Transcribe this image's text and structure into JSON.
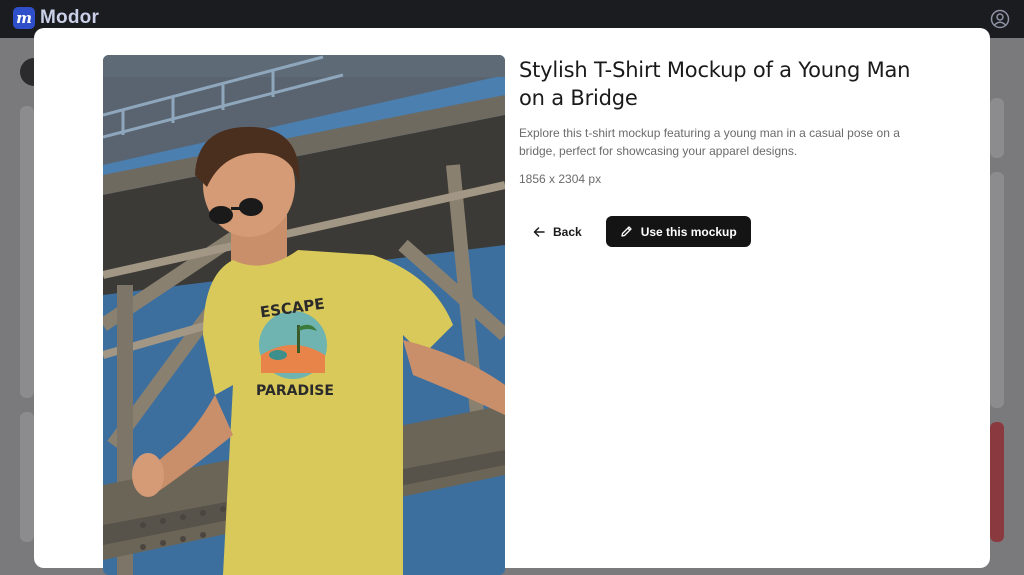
{
  "app": {
    "brand_letter": "m",
    "brand_name": "Modor"
  },
  "modal": {
    "title": "Stylish T-Shirt Mockup of a Young Man on a Bridge",
    "description": "Explore this t-shirt mockup featuring a young man in a casual pose on a bridge, perfect for showcasing your apparel designs.",
    "dimensions": "1856 x 2304 px",
    "back_label": "Back",
    "use_label": "Use this mockup"
  },
  "shirt_print": {
    "line1": "ESCAPE",
    "line2": "PARADISE"
  },
  "colors": {
    "shirt": "#d9c95a",
    "button_dark": "#141414",
    "sky": "#4b7fb0"
  }
}
